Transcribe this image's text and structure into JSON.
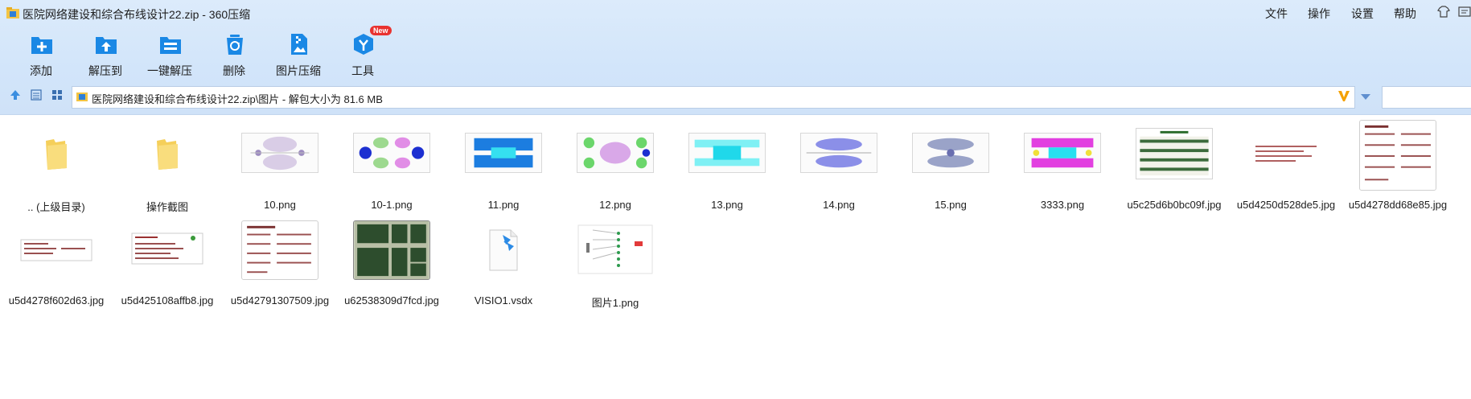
{
  "window": {
    "title": "医院网络建设和综合布线设计22.zip - 360压缩",
    "menus": [
      "文件",
      "操作",
      "设置",
      "帮助"
    ]
  },
  "toolbar": {
    "buttons": [
      {
        "label": "添加",
        "icon": "add-icon"
      },
      {
        "label": "解压到",
        "icon": "extract-to-icon"
      },
      {
        "label": "一键解压",
        "icon": "one-click-extract-icon"
      },
      {
        "label": "删除",
        "icon": "delete-icon"
      },
      {
        "label": "图片压缩",
        "icon": "image-compress-icon"
      },
      {
        "label": "工具",
        "icon": "tools-icon",
        "badge": "New"
      }
    ]
  },
  "address": {
    "path": "医院网络建设和综合布线设计22.zip\\图片 - 解包大小为 81.6 MB"
  },
  "files": [
    {
      "name": ".. (上级目录)",
      "kind": "folder"
    },
    {
      "name": "操作截图",
      "kind": "folder"
    },
    {
      "name": "10.png",
      "kind": "network"
    },
    {
      "name": "10-1.png",
      "kind": "network-blue"
    },
    {
      "name": "11.png",
      "kind": "network-cyan"
    },
    {
      "name": "12.png",
      "kind": "network-green"
    },
    {
      "name": "13.png",
      "kind": "network-cyan2"
    },
    {
      "name": "14.png",
      "kind": "network-purple"
    },
    {
      "name": "15.png",
      "kind": "network-grey"
    },
    {
      "name": "3333.png",
      "kind": "network-magenta"
    },
    {
      "name": "u5c25d6b0bc09f.jpg",
      "kind": "doc-table"
    },
    {
      "name": "u5d4250d528de5.jpg",
      "kind": "doc-text"
    },
    {
      "name": "u5d4278dd68e85.jpg",
      "kind": "doc-tall"
    },
    {
      "name": "u5d4278f602d63.jpg",
      "kind": "doc-wide"
    },
    {
      "name": "u5d425108affb8.jpg",
      "kind": "doc-text2"
    },
    {
      "name": "u5d42791307509.jpg",
      "kind": "doc-sign"
    },
    {
      "name": "u62538309d7fcd.jpg",
      "kind": "floorplan"
    },
    {
      "name": "VISIO1.vsdx",
      "kind": "file"
    },
    {
      "name": "图片1.png",
      "kind": "diagram"
    }
  ],
  "colors": {
    "toolbar_bg": "#d2e5fa",
    "accent_blue": "#1a88e5",
    "badge_red": "#e9322f",
    "folder_yellow": "#f5cf5a"
  }
}
